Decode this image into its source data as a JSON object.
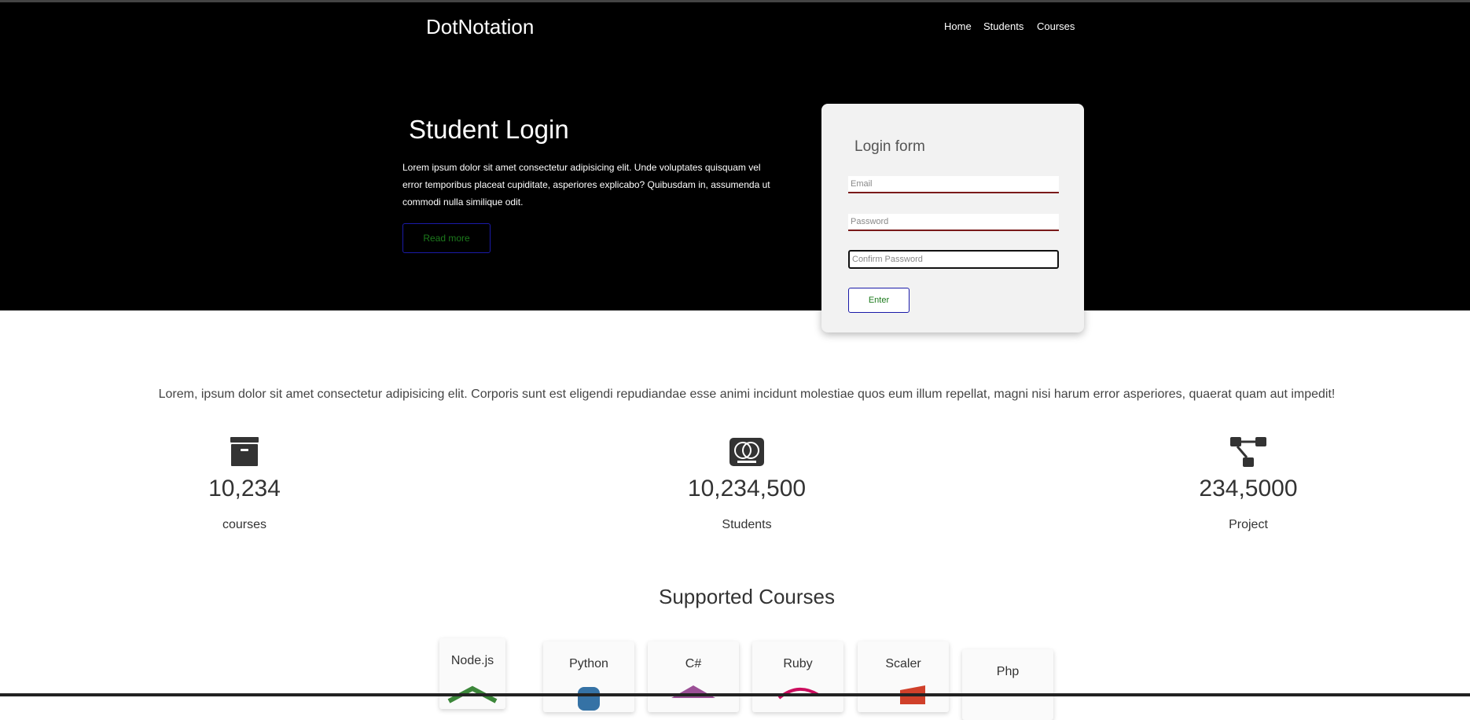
{
  "header": {
    "brand": "DotNotation",
    "nav": [
      "Home",
      "Students",
      "Courses"
    ]
  },
  "hero": {
    "title": "Student Login",
    "text": "Lorem ipsum dolor sit amet consectetur adipisicing elit. Unde voluptates quisquam vel error temporibus placeat cupiditate, asperiores explicabo? Quibusdam in, assumenda ut commodi nulla similique odit.",
    "read_more": "Read more"
  },
  "login_form": {
    "title": "Login form",
    "email_placeholder": "Email",
    "password_placeholder": "Password",
    "confirm_placeholder": "Confirm Password",
    "submit": "Enter"
  },
  "intro": "Lorem, ipsum dolor sit amet consectetur adipisicing elit. Corporis sunt est eligendi repudiandae esse animi incidunt molestiae quos eum illum repellat, magni nisi harum error asperiores, quaerat quam aut impedit!",
  "stats": [
    {
      "icon": "archive-box-icon",
      "value": "10,234",
      "label": "courses"
    },
    {
      "icon": "mastercard-icon",
      "value": "10,234,500",
      "label": "Students"
    },
    {
      "icon": "project-diagram-icon",
      "value": "234,5000",
      "label": "Project"
    }
  ],
  "courses": {
    "title": "Supported Courses",
    "items": [
      {
        "name": "Node.js",
        "icon": "nodejs-icon"
      },
      {
        "name": "Python",
        "icon": "python-icon"
      },
      {
        "name": "C#",
        "icon": "csharp-icon"
      },
      {
        "name": "Ruby",
        "icon": "ruby-icon"
      },
      {
        "name": "Scaler",
        "icon": "scaler-icon"
      },
      {
        "name": "Php",
        "icon": "php-icon"
      }
    ]
  },
  "colors": {
    "hero_bg": "#000000",
    "button_border": "#1a1aa8",
    "button_text": "#1c7a1c",
    "field_underline": "#7a1a1a",
    "card_bg": "#f2f2f2"
  }
}
